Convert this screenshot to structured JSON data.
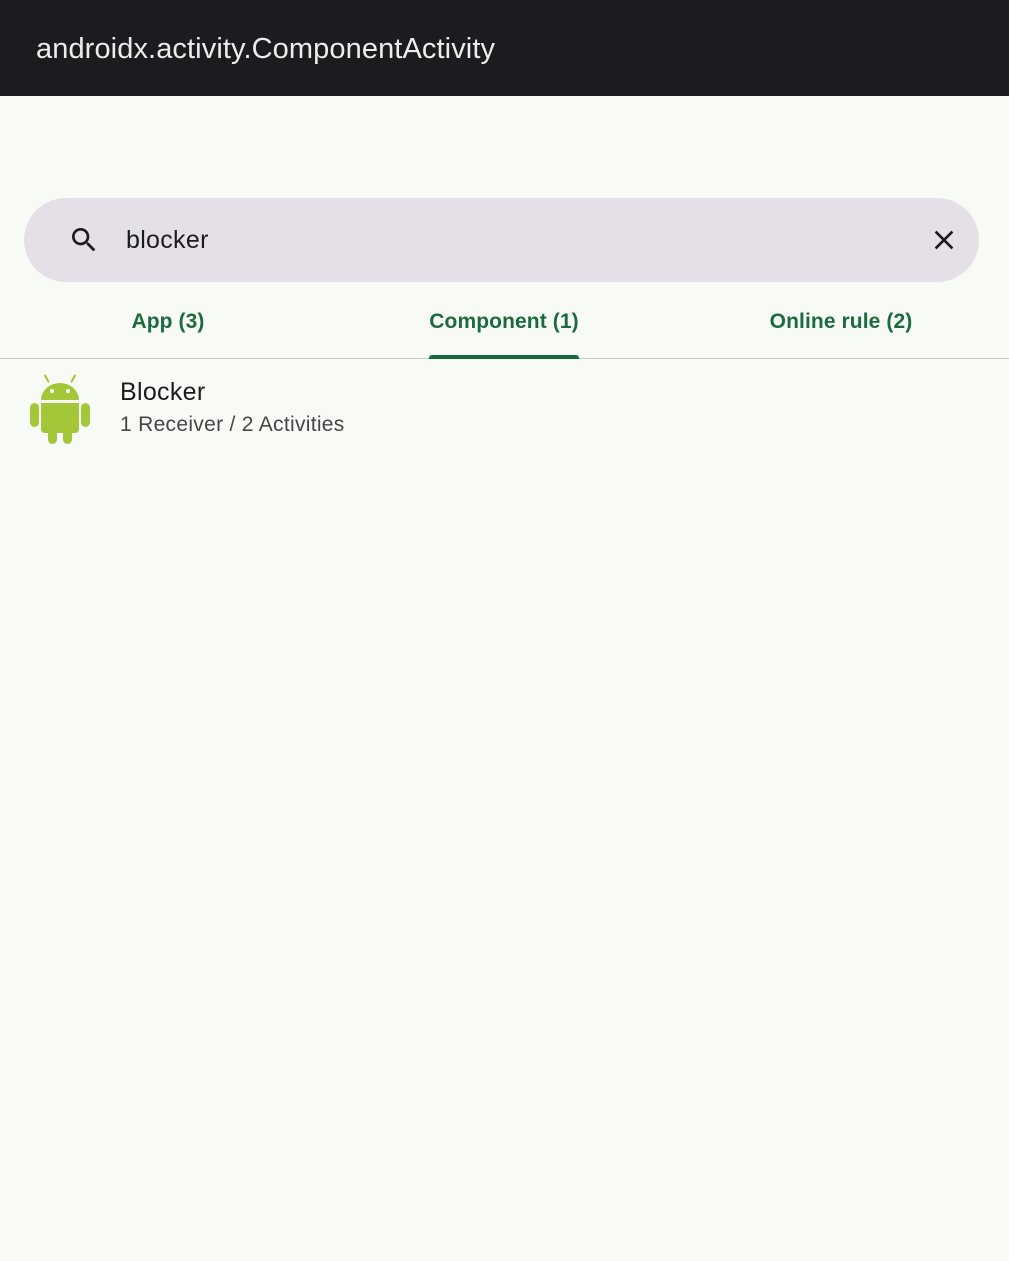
{
  "window": {
    "title": "androidx.activity.ComponentActivity"
  },
  "search": {
    "query": "blocker",
    "icon": "search-icon",
    "clear_icon": "close-icon"
  },
  "tabs": [
    {
      "label": "App (3)",
      "selected": false
    },
    {
      "label": "Component (1)",
      "selected": true
    },
    {
      "label": "Online rule (2)",
      "selected": false
    }
  ],
  "results": [
    {
      "name": "Blocker",
      "detail": "1 Receiver / 2 Activities",
      "icon": "android-robot-icon"
    }
  ],
  "colors": {
    "accent": "#16693d",
    "android_green": "#a4c639",
    "titlebar": "#1b1c1f",
    "search_bg": "#e5e0e7",
    "background": "#f8fbf5"
  }
}
